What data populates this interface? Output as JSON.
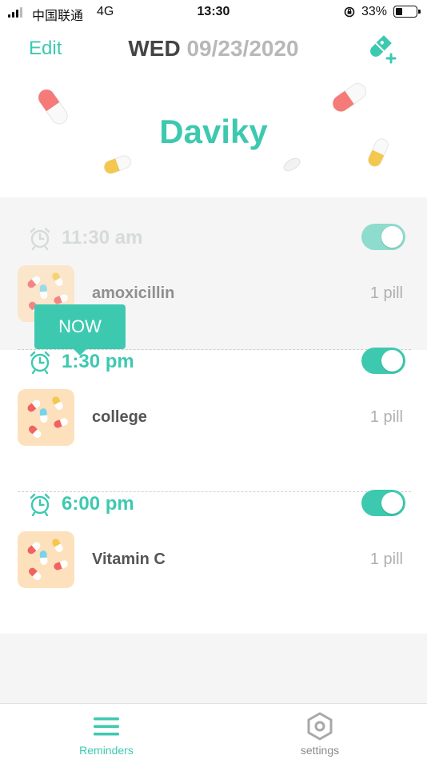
{
  "status_bar": {
    "carrier": "中国联通",
    "network": "4G",
    "time": "13:30",
    "battery": "33%",
    "battery_level": 0.33
  },
  "header": {
    "edit_label": "Edit",
    "day": "WED",
    "date": "09/23/2020",
    "add_icon": "add-pill-icon"
  },
  "hero": {
    "name": "Daviky"
  },
  "colors": {
    "accent": "#3dc9b0",
    "thumb_bg": "#fde1bd",
    "past_bg": "#f5f5f5"
  },
  "reminders": [
    {
      "time": "11:30 am",
      "enabled": true,
      "past": true,
      "medications": [
        {
          "name": "amoxicillin",
          "dose": "1 pill"
        }
      ]
    },
    {
      "time": "1:30 pm",
      "enabled": true,
      "past": false,
      "medications": [
        {
          "name": "college",
          "dose": "1 pill"
        }
      ]
    },
    {
      "time": "6:00 pm",
      "enabled": true,
      "past": false,
      "medications": [
        {
          "name": "Vitamin C",
          "dose": "1 pill"
        }
      ]
    }
  ],
  "now_badge": "NOW",
  "tab_bar": {
    "tabs": [
      {
        "label": "Reminders",
        "icon": "menu-icon",
        "active": true
      },
      {
        "label": "settings",
        "icon": "hexagon-settings-icon",
        "active": false
      }
    ]
  }
}
